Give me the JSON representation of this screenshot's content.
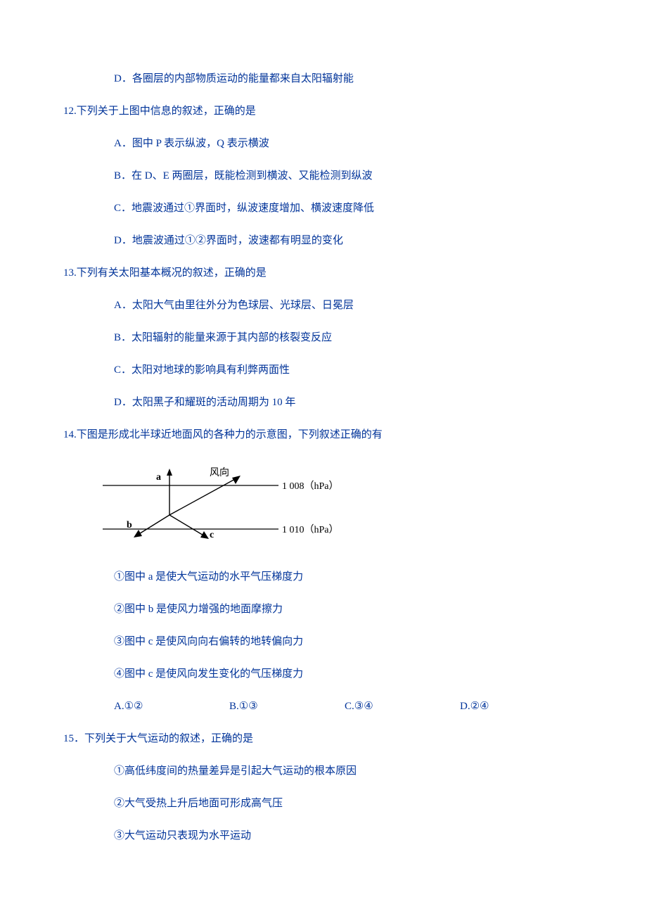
{
  "q11": {
    "optD": "D．各圈层的内部物质运动的能量都来自太阳辐射能"
  },
  "q12": {
    "stem": "12.下列关于上图中信息的叙述，正确的是",
    "optA": "A．图中 P 表示纵波，Q 表示横波",
    "optB": "B．在 D、E 两圈层，既能检测到横波、又能检测到纵波",
    "optC": "C．地震波通过①界面时，纵波速度增加、横波速度降低",
    "optD": "D．地震波通过①②界面时，波速都有明显的变化"
  },
  "q13": {
    "stem": "13.下列有关太阳基本概况的叙述，正确的是",
    "optA": "A．太阳大气由里往外分为色球层、光球层、日冕层",
    "optB": "B．太阳辐射的能量来源于其内部的核裂变反应",
    "optC": "C．太阳对地球的影响具有利弊两面性",
    "optD": "D．太阳黑子和耀斑的活动周期为 10 年"
  },
  "q14": {
    "stem": "14.下图是形成北半球近地面风的各种力的示意图，下列叙述正确的有",
    "diagram": {
      "label_a": "a",
      "label_b": "b",
      "label_c": "c",
      "label_wind": "风向",
      "iso1": "1 008（hPa）",
      "iso2": "1 010（hPa）"
    },
    "s1": "①图中 a 是使大气运动的水平气压梯度力",
    "s2": "②图中 b 是使风力增强的地面摩擦力",
    "s3": "③图中 c 是使风向向右偏转的地转偏向力",
    "s4": "④图中 c 是使风向发生变化的气压梯度力",
    "optA": "A.①②",
    "optB": "B.①③",
    "optC": "C.③④",
    "optD": "D.②④"
  },
  "q15": {
    "stem": "15．下列关于大气运动的叙述，正确的是",
    "s1": "①高低纬度间的热量差异是引起大气运动的根本原因",
    "s2": "②大气受热上升后地面可形成高气压",
    "s3": "③大气运动只表现为水平运动"
  }
}
